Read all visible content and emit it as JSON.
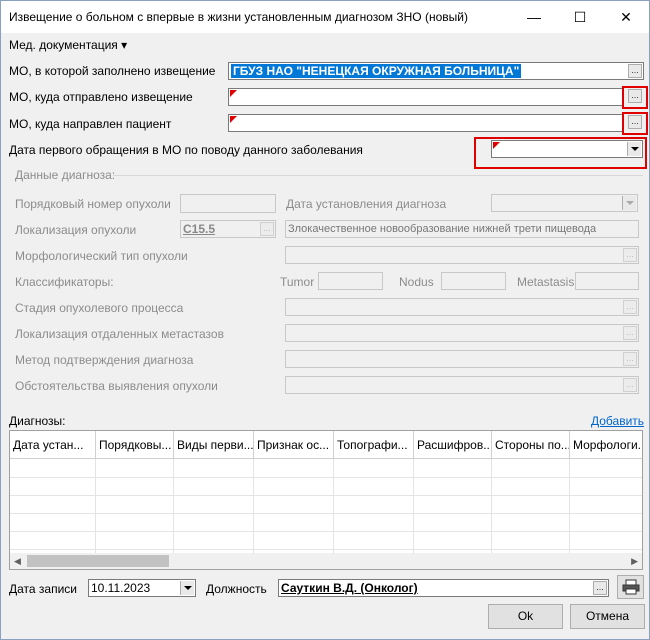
{
  "window": {
    "title": "Извещение о больном с впервые в жизни установленным диагнозом ЗНО (новый)",
    "minimize": "—",
    "maximize": "☐",
    "close": "✕"
  },
  "menu": {
    "med_docs": "Мед. документация ▾"
  },
  "form": {
    "mo_filled_label": "МО, в которой заполнено извещение",
    "mo_filled_value": "ГБУЗ НАО \"НЕНЕЦКАЯ ОКРУЖНАЯ БОЛЬНИЦА\"",
    "mo_sent_label": "МО, куда отправлено извещение",
    "mo_sent_value": "",
    "mo_patient_label": "МО, куда направлен пациент",
    "mo_patient_value": "",
    "first_visit_label": "Дата первого обращения в МО по поводу данного заболевания",
    "first_visit_value": "",
    "dots": "..."
  },
  "diagnosis_data": {
    "section_title": "Данные диагноза:",
    "tumor_number_label": "Порядковый номер опухоли",
    "diag_date_label": "Дата установления диагноза",
    "tumor_loc_label": "Локализация опухоли",
    "tumor_loc_code": "C15.5",
    "tumor_loc_desc": "Злокачественное новообразование нижней трети пищевода",
    "morph_label": "Морфологический тип опухоли",
    "classifiers_label": "Классификаторы:",
    "tumor_label": "Tumor",
    "nodus_label": "Nodus",
    "metastasis_label": "Metastasis",
    "stage_label": "Стадия опухолевого процесса",
    "meta_loc_label": "Локализация отдаленных метастазов",
    "confirm_method_label": "Метод подтверждения диагноза",
    "circumstances_label": "Обстоятельства выявления опухоли"
  },
  "diagnoses": {
    "label": "Диагнозы:",
    "add_link": "Добавить",
    "columns": [
      "Дата устан...",
      "Порядковы...",
      "Виды перви...",
      "Признак ос...",
      "Топографи...",
      "Расшифров...",
      "Стороны по...",
      "Морфологи..."
    ]
  },
  "footer": {
    "record_date_label": "Дата записи",
    "record_date_value": "10.11.2023",
    "position_label": "Должность",
    "position_value": "Сауткин В.Д. (Онколог)",
    "ok": "Ok",
    "cancel": "Отмена",
    "print_icon": "printer-icon"
  },
  "colors": {
    "required_marker": "#e00000",
    "highlight_red": "#e00000",
    "selection": "#0078d7",
    "link": "#0066cc"
  }
}
